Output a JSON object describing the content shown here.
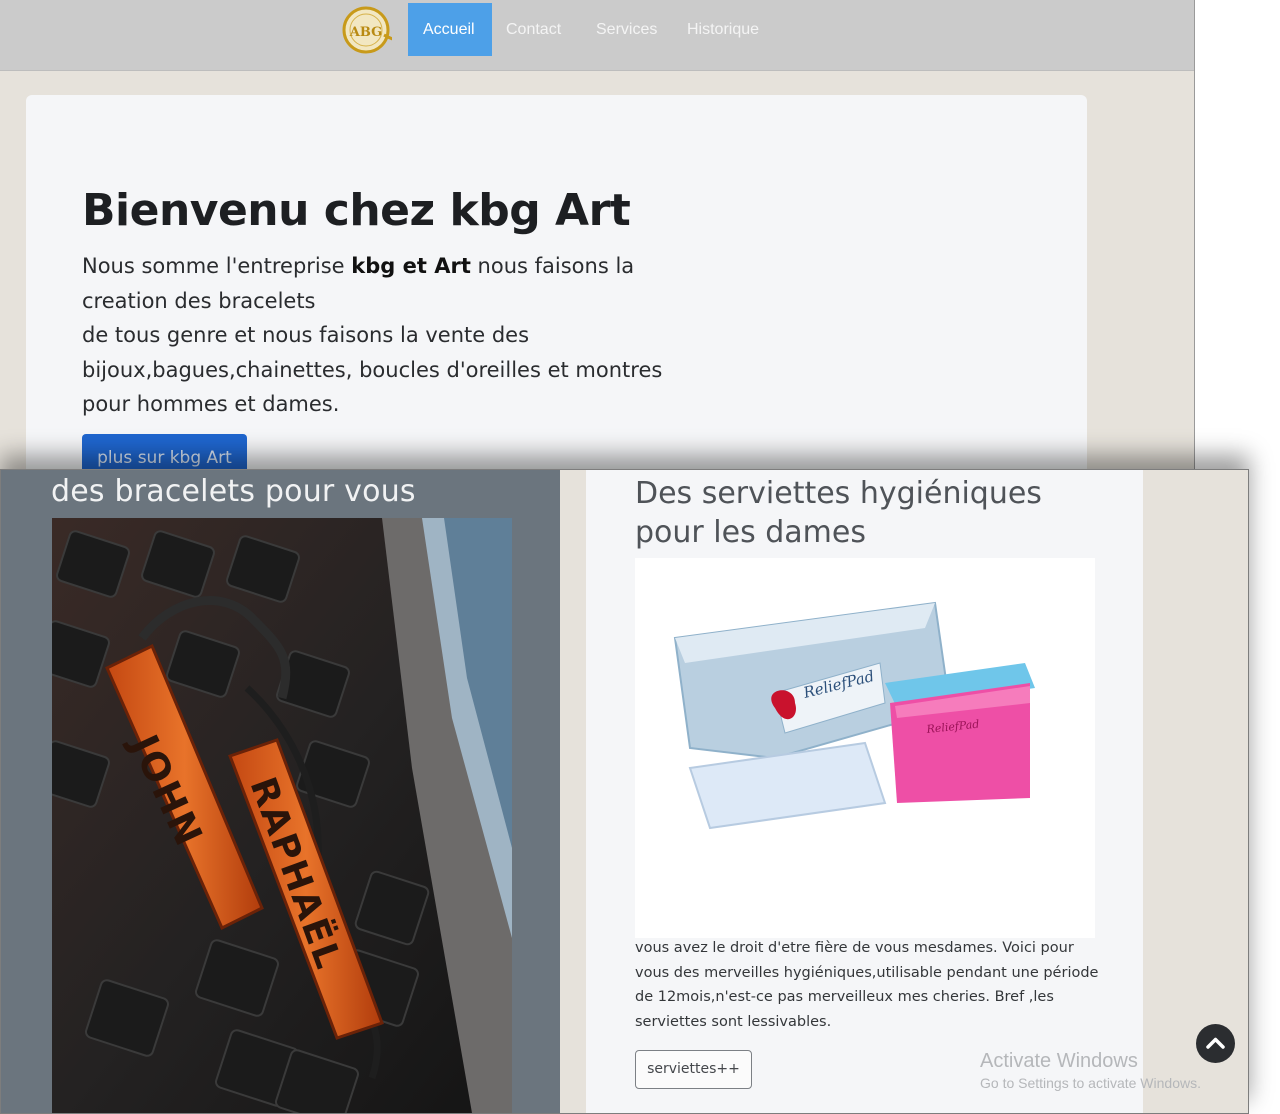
{
  "nav": {
    "logo_text": "ABG",
    "items": [
      {
        "label": "Accueil",
        "active": true
      },
      {
        "label": "Contact",
        "active": false
      },
      {
        "label": "Services",
        "active": false
      },
      {
        "label": "Historique",
        "active": false
      }
    ]
  },
  "hero": {
    "title": "Bienvenu chez kbg Art",
    "text_part1": "Nous somme l'entreprise ",
    "text_bold": "kbg et Art",
    "text_part2": " nous faisons la creation des bracelets",
    "text_line2": "de tous genre et nous faisons la vente des bijoux,bagues,chainettes, boucles d'oreilles et montres pour hommes et dames.",
    "button_label": "plus sur kbg Art"
  },
  "bracelets": {
    "heading": "des bracelets pour vous",
    "bracelet_names": [
      "JOHN",
      "RAPHAËL"
    ]
  },
  "pads": {
    "heading": "Des serviettes hygiéniques pour les dames",
    "brand_on_pack": "ReliefPad",
    "text": "vous avez le droit d'etre fière de vous mesdames. Voici pour vous des merveilles hygiéniques,utilisable pendant une période de 12mois,n'est-ce pas merveilleux mes cheries. Bref ,les serviettes sont lessivables.",
    "button_label": "serviettes++"
  },
  "watermark": {
    "title": "Activate Windows",
    "subtitle": "Go to Settings to activate Windows."
  },
  "colors": {
    "nav_bg": "#cbcbcb",
    "nav_active": "#4da0e8",
    "hero_button": "#1f66cf",
    "left_column": "#6b757e",
    "page_bg": "#e6e2db"
  }
}
